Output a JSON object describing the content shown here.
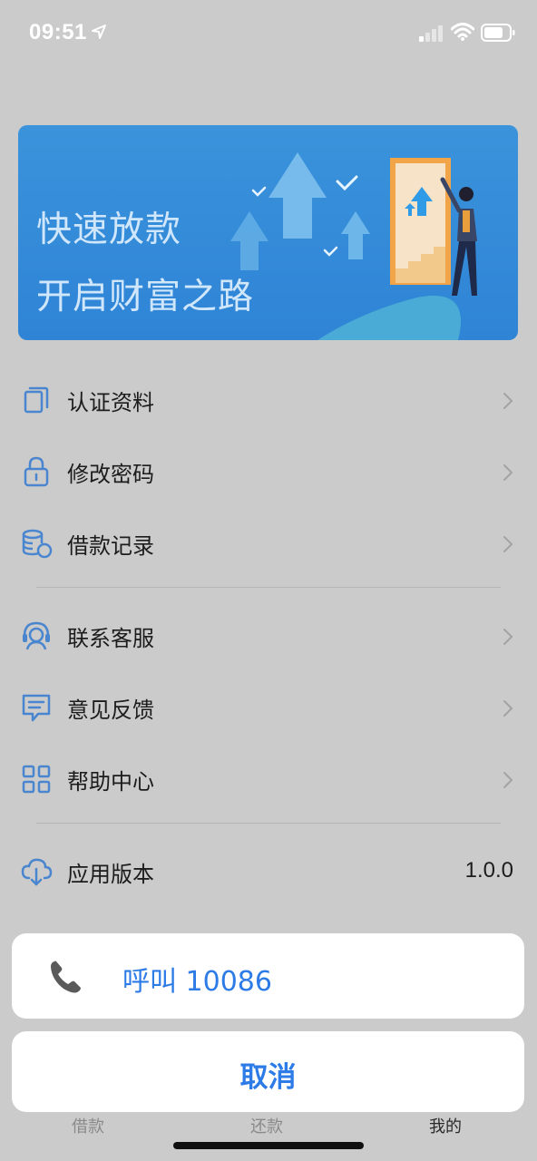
{
  "status_bar": {
    "time": "09:51",
    "icons": [
      "location-arrow-icon",
      "cellular-signal-icon",
      "wifi-icon",
      "battery-icon"
    ]
  },
  "banner": {
    "line1": "快速放款",
    "line2": "开启财富之路"
  },
  "menu": {
    "items": [
      {
        "label": "认证资料",
        "icon": "document-copy-icon"
      },
      {
        "label": "修改密码",
        "icon": "lock-icon"
      },
      {
        "label": "借款记录",
        "icon": "coins-stack-icon"
      },
      {
        "label": "联系客服",
        "icon": "customer-service-icon"
      },
      {
        "label": "意见反馈",
        "icon": "feedback-message-icon"
      },
      {
        "label": "帮助中心",
        "icon": "grid-icon"
      },
      {
        "label": "应用版本",
        "icon": "cloud-download-icon",
        "value": "1.0.0"
      }
    ]
  },
  "tab_bar": {
    "tabs": [
      {
        "label": "借款",
        "active": false
      },
      {
        "label": "还款",
        "active": false
      },
      {
        "label": "我的",
        "active": true
      }
    ]
  },
  "action_sheet": {
    "call_label": "呼叫 10086",
    "cancel_label": "取消"
  },
  "colors": {
    "accent": "#2d7be6",
    "icon_blue": "#4a86cf",
    "banner_blue": "#3a93db",
    "overlay_background": "#cbcbcb"
  }
}
